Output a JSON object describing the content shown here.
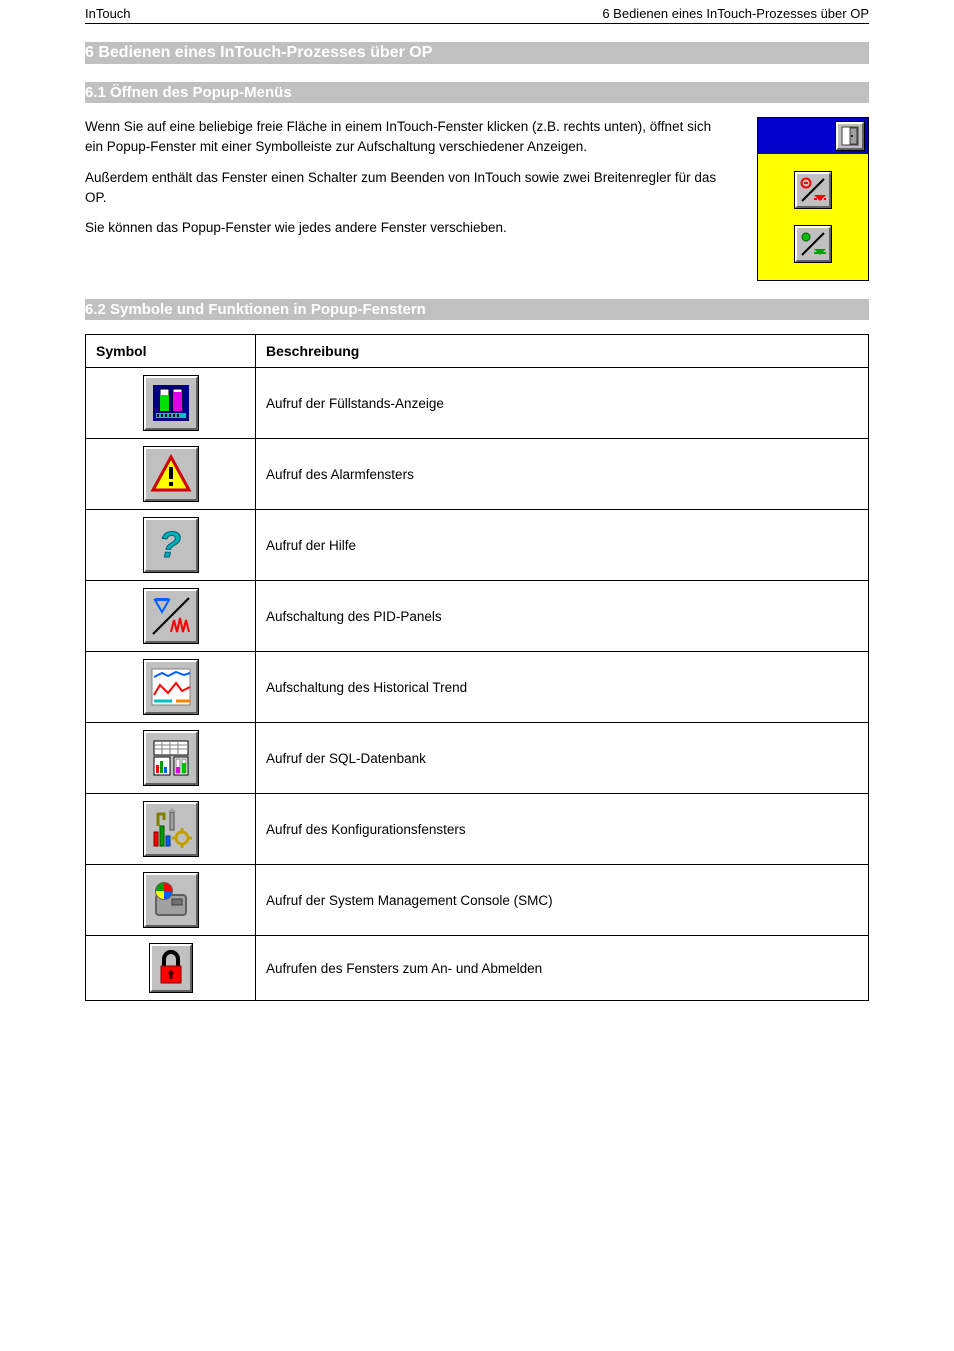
{
  "header": {
    "left": "InTouch",
    "right": "6 Bedienen eines InTouch-Prozesses über OP"
  },
  "h1": "6 Bedienen eines InTouch-Prozesses über OP",
  "h2a": "6.1 Öffnen des Popup-Menüs",
  "popup_text": {
    "p1": "Wenn Sie auf eine beliebige freie Fläche in einem InTouch-Fenster klicken (z.B. rechts unten), öffnet sich ein Popup-Fenster mit einer Symbolleiste zur Aufschaltung verschiedener Anzeigen.",
    "p2": "Außerdem enthält das Fenster einen Schalter zum Beenden von InTouch sowie zwei Breitenregler für das OP.",
    "p3": "Sie können das Popup-Fenster wie jedes andere Fenster verschieben."
  },
  "h2b": "6.2 Symbole und Funktionen in Popup-Fenstern",
  "table": {
    "hdr_icon": "Symbol",
    "hdr_desc": "Beschreibung",
    "rows": [
      {
        "key": "levels",
        "desc": "Aufruf der Füllstands-Anzeige"
      },
      {
        "key": "alarm",
        "desc": "Aufruf des Alarmfensters"
      },
      {
        "key": "help",
        "desc": "Aufruf der Hilfe"
      },
      {
        "key": "pid",
        "desc": "Aufschaltung des PID-Panels"
      },
      {
        "key": "trend",
        "desc": "Aufschaltung des Historical Trend"
      },
      {
        "key": "sql",
        "desc": "Aufruf der SQL-Datenbank"
      },
      {
        "key": "config",
        "desc": "Aufruf des Konfigurationsfensters"
      },
      {
        "key": "smc",
        "desc": "Aufruf der System Management Console (SMC)"
      },
      {
        "key": "lock",
        "desc": "Aufrufen des Fensters zum An- und Abmelden"
      }
    ]
  }
}
